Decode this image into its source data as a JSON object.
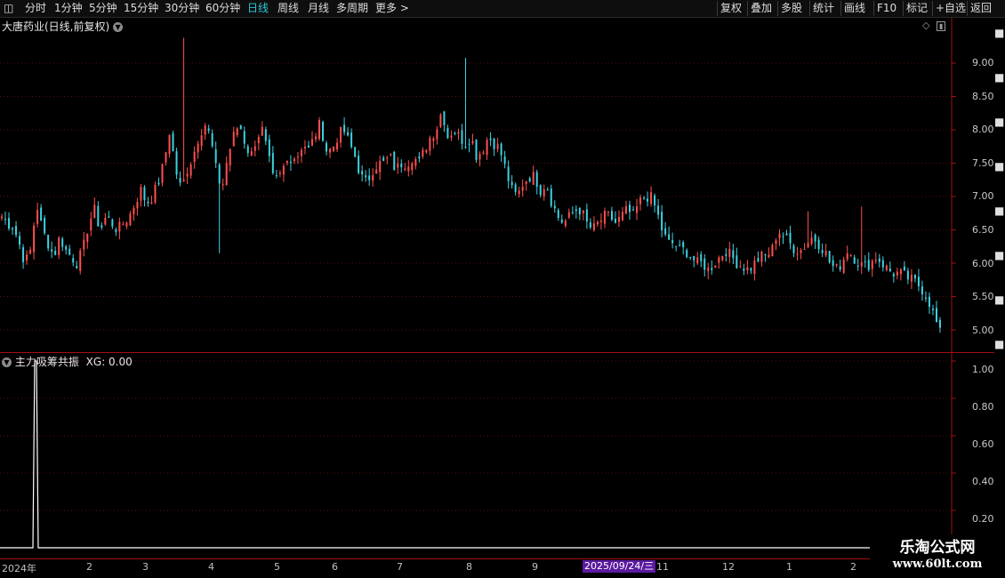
{
  "toolbar": {
    "left_items": [
      "分时",
      "1分钟",
      "5分钟",
      "15分钟",
      "30分钟",
      "60分钟",
      "日线",
      "周线",
      "月线",
      "多周期",
      "更多 >"
    ],
    "active_item": "日线",
    "right_items": [
      "复权",
      "叠加",
      "多股",
      "统计",
      "画线",
      "F10",
      "标记",
      "+自选",
      "返回"
    ]
  },
  "main_panel": {
    "title": "大唐药业(日线,前复权)",
    "y_ticks": [
      "9.00",
      "8.50",
      "8.00",
      "7.50",
      "7.00",
      "6.50",
      "6.00",
      "5.50",
      "5.00"
    ],
    "icons": [
      "diamond-icon",
      "window-icon"
    ]
  },
  "indicator_panel": {
    "title": "主力吸筹共振",
    "xg_label": "XG: 0.00",
    "y_ticks": [
      "1.00",
      "0.80",
      "0.60",
      "0.40",
      "0.20"
    ]
  },
  "x_axis": {
    "labels": [
      "2024年",
      "2",
      "3",
      "4",
      "5",
      "6",
      "7",
      "8",
      "9",
      "11",
      "12",
      "1",
      "2"
    ],
    "crosshair_date": "2025/09/24/三"
  },
  "watermark": {
    "line1": "乐淘公式网",
    "line2": "www.60lt.com"
  },
  "colors": {
    "up": "#ff4f4f",
    "down": "#3ed1e0",
    "grid": "#5a0d0d",
    "axis": "#a01010",
    "active": "#29c9d8",
    "badge": "#5b1aa0"
  },
  "chart_data": {
    "type": "candlestick",
    "title": "大唐药业(日线,前复权)",
    "ylim": [
      4.85,
      9.3
    ],
    "close_path": [
      6.7,
      6.6,
      6.55,
      6.3,
      6.0,
      6.2,
      6.9,
      6.5,
      6.3,
      6.1,
      6.4,
      6.2,
      6.1,
      6.0,
      6.2,
      6.6,
      6.8,
      6.5,
      6.7,
      6.6,
      6.5,
      6.6,
      6.7,
      6.9,
      7.1,
      6.9,
      7.0,
      7.2,
      7.5,
      8.0,
      7.4,
      7.1,
      7.4,
      7.6,
      7.9,
      8.1,
      7.9,
      7.4,
      7.1,
      7.6,
      7.9,
      8.1,
      7.8,
      7.6,
      7.9,
      8.0,
      7.6,
      7.2,
      7.3,
      7.5,
      7.6,
      7.6,
      7.8,
      7.7,
      7.9,
      8.1,
      7.7,
      7.7,
      7.9,
      8.0,
      7.8,
      7.6,
      7.3,
      7.2,
      7.4,
      7.5,
      7.5,
      7.6,
      7.4,
      7.5,
      7.5,
      7.6,
      7.5,
      7.7,
      7.9,
      8.0,
      8.3,
      7.9,
      8.0,
      7.9,
      7.8,
      7.9,
      7.6,
      7.7,
      7.9,
      7.8,
      7.7,
      7.4,
      7.1,
      7.0,
      7.2,
      7.3,
      7.3,
      7.1,
      7.2,
      6.9,
      6.7,
      6.6,
      6.7,
      6.8,
      6.8,
      6.6,
      6.5,
      6.6,
      6.7,
      6.7,
      6.6,
      6.7,
      6.8,
      6.7,
      6.9,
      7.0,
      7.0,
      6.8,
      6.5,
      6.3,
      6.3,
      6.2,
      6.2,
      6.1,
      6.0,
      6.0,
      5.9,
      6.0,
      6.1,
      6.2,
      6.1,
      6.0,
      5.95,
      5.9,
      6.0,
      6.1,
      6.1,
      6.2,
      6.5,
      6.4,
      6.3,
      6.2,
      6.2,
      6.3,
      6.4,
      6.3,
      6.2,
      6.0,
      5.9,
      6.0,
      6.2,
      6.1,
      6.0,
      5.95,
      6.0,
      6.1,
      6.0,
      5.9,
      5.85,
      5.85,
      5.8,
      5.75,
      5.7,
      5.6,
      5.45,
      5.2,
      4.95
    ],
    "indicator": {
      "name": "XG",
      "value": 0.0,
      "ylim": [
        0,
        1.05
      ],
      "spike_at_fraction": 0.035,
      "spike_value": 1.0
    }
  }
}
